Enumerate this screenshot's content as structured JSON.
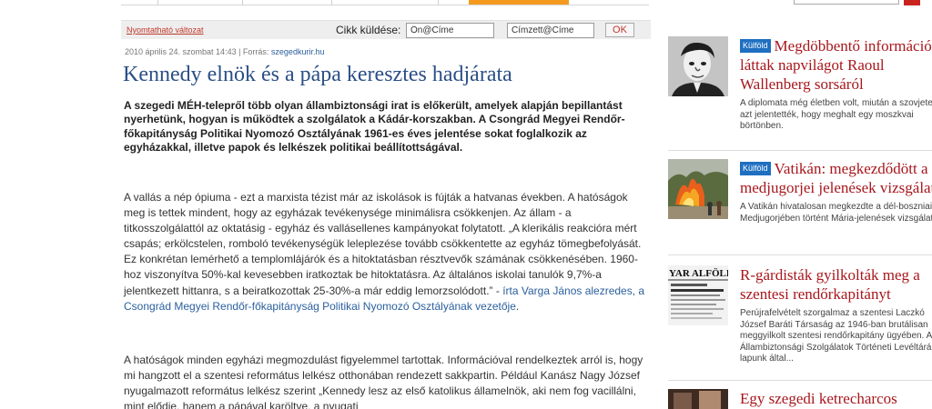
{
  "toolbar": {
    "print_label": "Nyomtatható változat",
    "send_label": "Cikk küldése:",
    "from_value": "Ön@Címe",
    "to_value": "Címzett@Címe",
    "ok_label": "OK"
  },
  "article": {
    "meta_date": "2010 április 24. szombat 14:43 | Forrás: ",
    "meta_source": "szegedkurir.hu",
    "title": "Kennedy elnök és a pápa keresztes hadjárata",
    "lead": "A szegedi MÉH-telepről több olyan állambiztonsági irat is előkerült, amelyek alapján bepillantást nyerhetünk, hogyan is működtek a szolgálatok a Kádár-korszakban. A Csongrád Megyei Rendőr-főkapitányság Politikai Nyomozó Osztályának 1961-es éves jelentése sokat foglalkozik az egyházakkal, illetve papok és lelkészek politikai beállítottságával.",
    "p1": "A vallás a nép ópiuma - ezt a marxista tézist már az iskolások is fújták a hatvanas években. A hatóságok meg is tettek mindent, hogy az egyházak tevékenysége minimálisra csökkenjen. Az állam - a titkosszolgálattól az oktatásig - egyház és vallásellenes kampányokat folytatott. „A klerikális reakcióra mért csapás; erkölcstelen, romboló tevékenységük leleplezése tovább csökkentette az egyház tömegbefolyását. Ez konkrétan lemérhető a templomlájárók és a hitoktatásban résztvevők számának csökkenésében. 1960-hoz viszonyítva 50%-kal kevesebben iratkoztak be hitoktatásra. Az általános iskolai tanulók 9,7%-a jelentkezett hittanra, s a beiratkozottak 25-30%-a már eddig lemorzsolódott.” - ",
    "p1_link": "írta Varga János alezredes, a Csongrád Megyei Rendőr-főkapitányság Politikai Nyomozó Osztályának vezetője",
    "p1_end": ".",
    "p2": "A hatóságok minden egyházi megmozdulást figyelemmel tartottak. Információval rendelkeztek arról is, hogy mi hangzott el a szentesi református lelkész otthonában rendezett sakkpartin. Például Kanász Nagy József nyugalmazott református lelkész szerint „Kennedy lesz az első katolikus államelnök, aki nem fog vacillálni, mint elődje, hanem a pápával karöltve, a nyugati"
  },
  "sidebar": {
    "items": [
      {
        "tag": "Külföld",
        "headline": "Megdöbbentő információk láttak napvilágot Raoul Wallenberg sorsáról",
        "desc": "A diplomata még életben volt, miután a szovjetek azt jelentették, hogy meghalt egy moszkvai börtönben.",
        "thumb": "portrait-photo"
      },
      {
        "tag": "Külföld",
        "headline": "Vatikán: megkezdődött a medjugorjei jelenések vizsgálata",
        "desc": "A Vatikán hivatalosan megkezdte a dél-boszniai Medjugorjében történt Mária-jelenések vizsgálatát.",
        "thumb": "fire-photo"
      },
      {
        "tag": "",
        "headline": "R-gárdisták gyilkolták meg a szentesi rendőrkapitányt",
        "desc": "Perújrafelvételt szorgalmaz a szentesi Laczkó József Baráti Társaság az 1946-ban brutálisan meggyilkolt szentesi rendőrkapitány ügyében. Az Állambiztonsági Szolgálatok Történeti Levéltárából lapunk által...",
        "thumb": "newspaper-photo",
        "thumb_title": "YAR ALFÖLD"
      },
      {
        "tag": "",
        "headline": "Egy szegedi ketrecharcos",
        "desc": "",
        "thumb": "photo"
      }
    ]
  }
}
